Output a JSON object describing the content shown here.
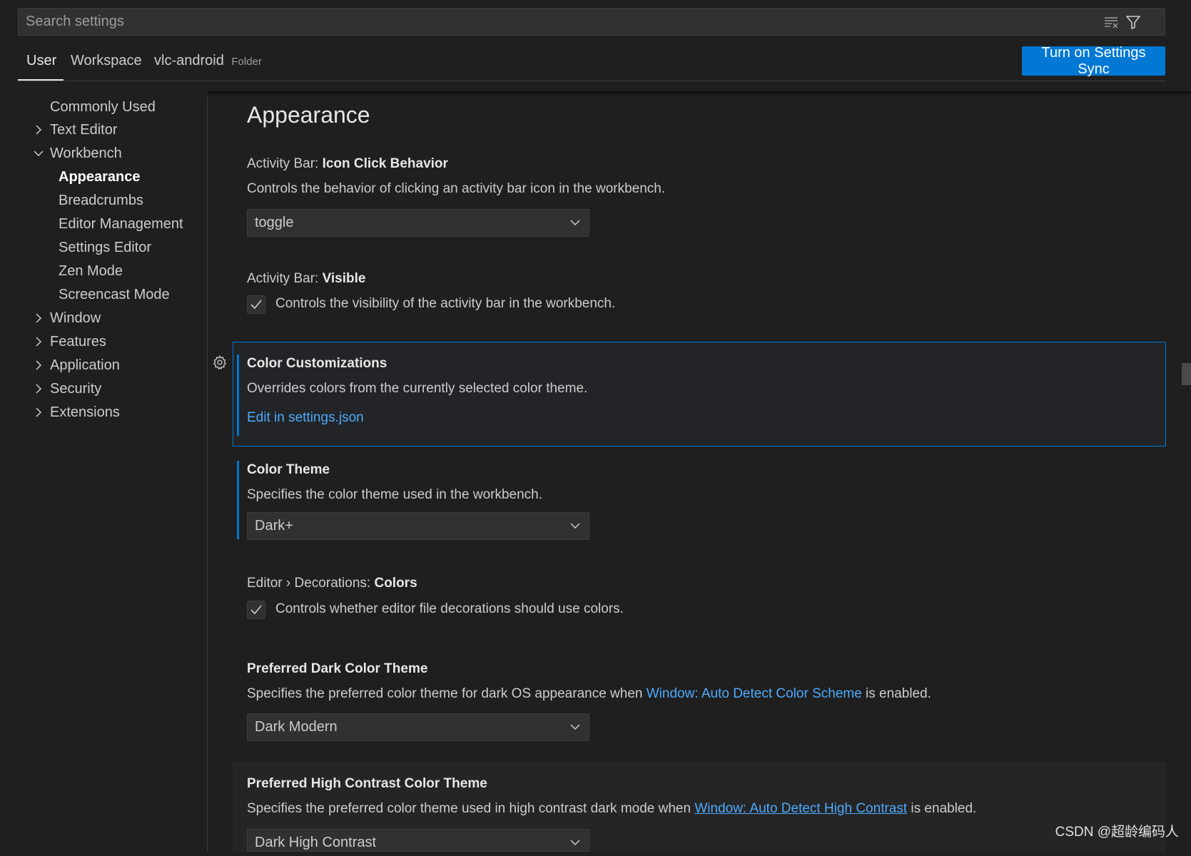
{
  "search": {
    "placeholder": "Search settings"
  },
  "tabs": [
    {
      "label": "User",
      "active": true
    },
    {
      "label": "Workspace"
    },
    {
      "label": "vlc-android",
      "badge": "Folder"
    }
  ],
  "sync_button": "Turn on Settings Sync",
  "toc": [
    {
      "label": "Commonly Used",
      "chevron": "none"
    },
    {
      "label": "Text Editor",
      "chevron": "right"
    },
    {
      "label": "Workbench",
      "chevron": "down"
    },
    {
      "label": "Appearance",
      "active": true
    },
    {
      "label": "Breadcrumbs"
    },
    {
      "label": "Editor Management"
    },
    {
      "label": "Settings Editor"
    },
    {
      "label": "Zen Mode"
    },
    {
      "label": "Screencast Mode"
    },
    {
      "label": "Window",
      "chevron": "right"
    },
    {
      "label": "Features",
      "chevron": "right"
    },
    {
      "label": "Application",
      "chevron": "right"
    },
    {
      "label": "Security",
      "chevron": "right"
    },
    {
      "label": "Extensions",
      "chevron": "right"
    }
  ],
  "section_title": "Appearance",
  "settings": {
    "icon_click": {
      "category": "Activity Bar: ",
      "name": "Icon Click Behavior",
      "description": "Controls the behavior of clicking an activity bar icon in the workbench.",
      "value": "toggle"
    },
    "activity_visible": {
      "category": "Activity Bar: ",
      "name": "Visible",
      "description": "Controls the visibility of the activity bar in the workbench.",
      "checked": true
    },
    "color_customizations": {
      "name": "Color Customizations",
      "description": "Overrides colors from the currently selected color theme.",
      "link": "Edit in settings.json"
    },
    "color_theme": {
      "name": "Color Theme",
      "description": "Specifies the color theme used in the workbench.",
      "value": "Dark+"
    },
    "decorations_colors": {
      "category": "Editor › Decorations: ",
      "name": "Colors",
      "description": "Controls whether editor file decorations should use colors.",
      "checked": true
    },
    "preferred_dark": {
      "name": "Preferred Dark Color Theme",
      "description_before": "Specifies the preferred color theme for dark OS appearance when ",
      "description_link": "Window: Auto Detect Color Scheme",
      "description_after": " is enabled.",
      "value": "Dark Modern"
    },
    "preferred_hc": {
      "name": "Preferred High Contrast Color Theme",
      "description_before": "Specifies the preferred color theme used in high contrast dark mode when ",
      "description_link": "Window: Auto Detect High Contrast",
      "description_after": " is enabled.",
      "value": "Dark High Contrast"
    }
  },
  "watermark": "CSDN @超龄编码人",
  "icons": {
    "clear_filter": "clear-filter-icon",
    "filter": "filter-icon",
    "gear": "gear-icon",
    "chevron_right": "chevron-right-icon",
    "chevron_down": "chevron-down-icon",
    "check": "check-icon"
  },
  "colors": {
    "background": "#1f1f1f",
    "accent": "#0078d4",
    "link": "#4daafc",
    "text": "#cccccc"
  }
}
